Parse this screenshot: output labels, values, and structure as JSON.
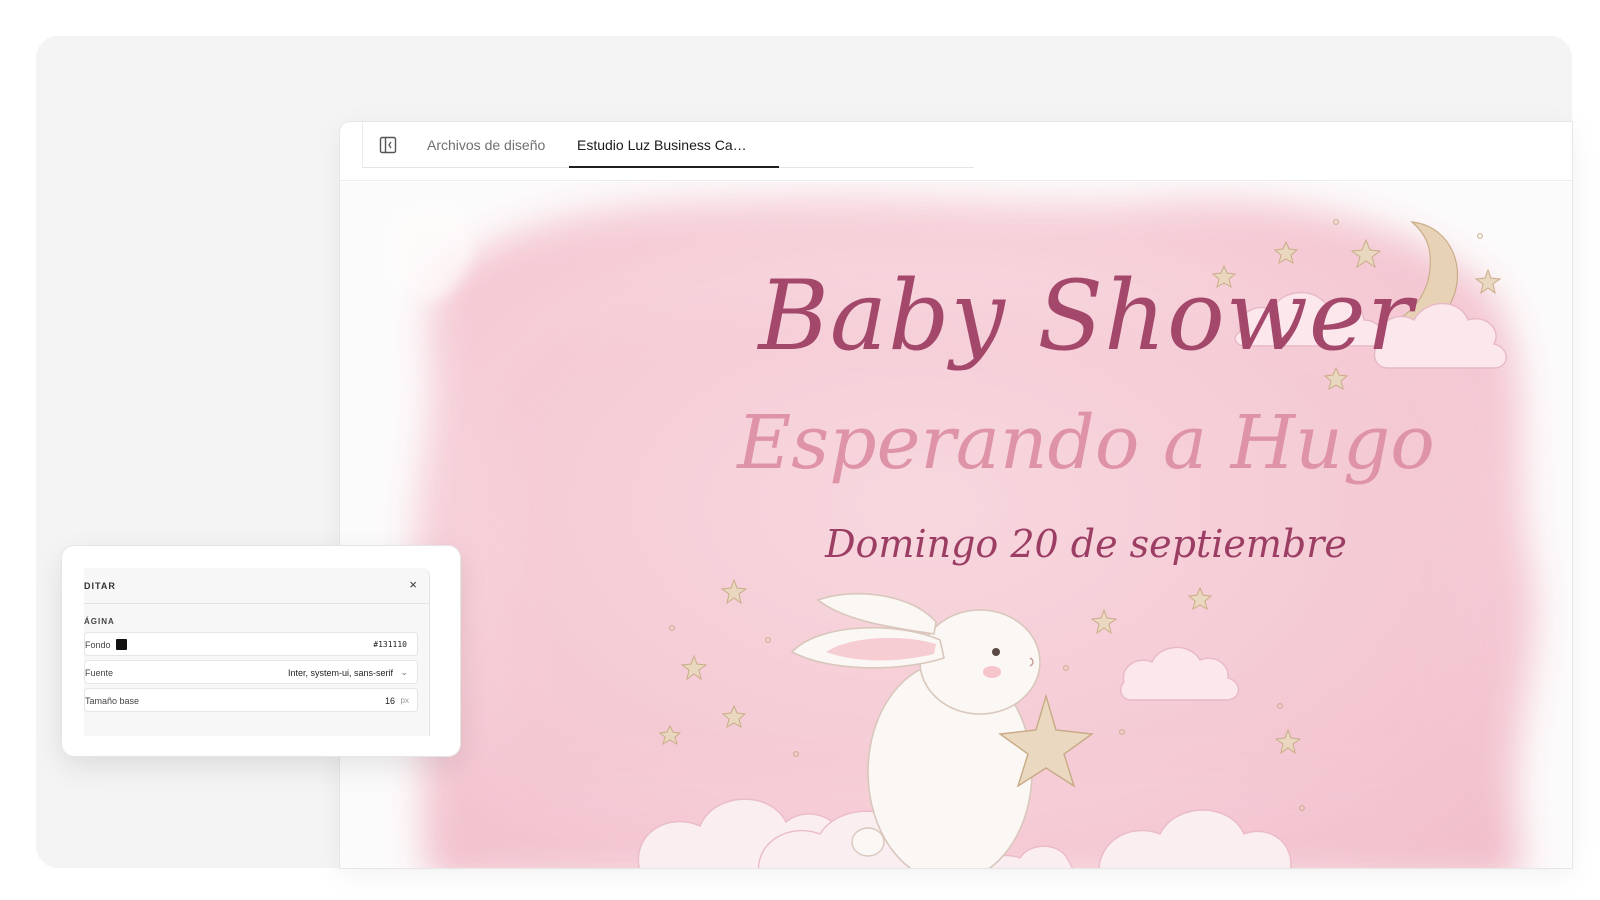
{
  "tabs": {
    "files_label": "Archivos de diseño",
    "active_label": "Estudio Luz Business Ca…"
  },
  "invitation": {
    "title": "Baby Shower",
    "subtitle": "Esperando a Hugo",
    "date": "Domingo 20 de septiembre"
  },
  "editor": {
    "title": "DITAR",
    "close": "×",
    "section": "ÁGINA",
    "background": {
      "label": "Fondo",
      "value": "#131110",
      "color": "#131110"
    },
    "font": {
      "label": "Fuente",
      "value": "Inter, system-ui, sans-serif"
    },
    "base_size": {
      "label": "Tamaño base",
      "value": "16",
      "unit": "px"
    }
  },
  "colors": {
    "title": "#a4486b",
    "subtitle": "#de94a6",
    "date": "#9c3e63",
    "wash": "#f4c6d1"
  },
  "icons": [
    "sidebar-toggle-icon",
    "close-icon",
    "chevron-down-icon",
    "moon-icon",
    "star-icon",
    "cloud-icon",
    "bunny-illustration"
  ]
}
